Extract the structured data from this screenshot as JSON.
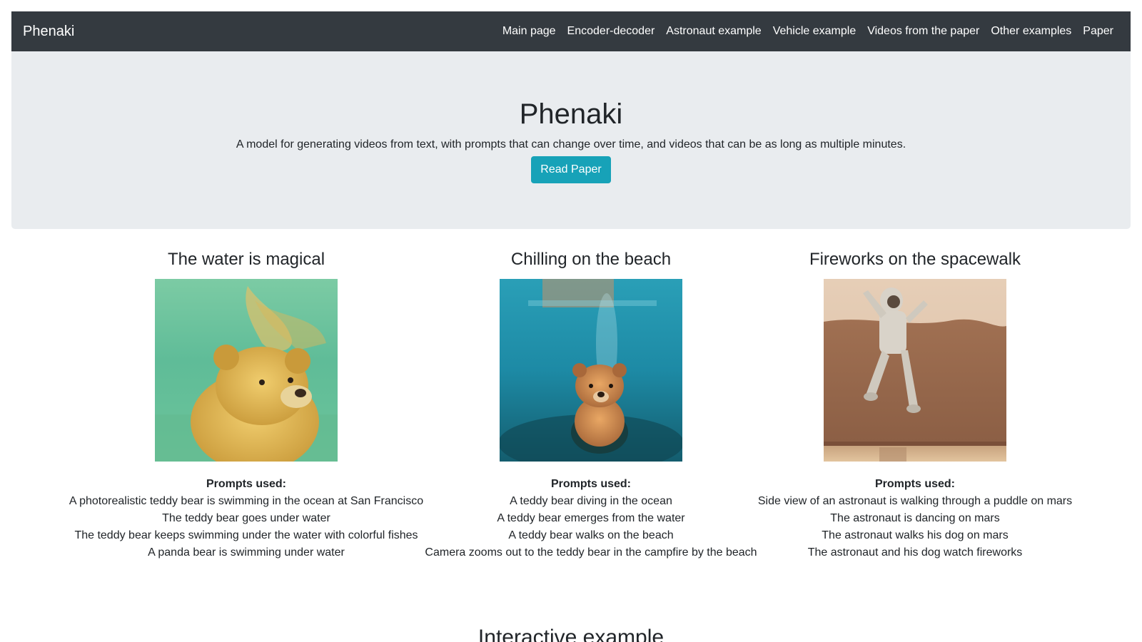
{
  "navbar": {
    "brand": "Phenaki",
    "links": [
      {
        "label": "Main page"
      },
      {
        "label": "Encoder-decoder"
      },
      {
        "label": "Astronaut example"
      },
      {
        "label": "Vehicle example"
      },
      {
        "label": "Videos from the paper"
      },
      {
        "label": "Other examples"
      },
      {
        "label": "Paper"
      }
    ]
  },
  "hero": {
    "title": "Phenaki",
    "subtitle": "A model for generating videos from text, with prompts that can change over time, and videos that can be as long as multiple minutes.",
    "button_label": "Read Paper"
  },
  "examples": [
    {
      "title": "The water is magical",
      "prompts_label": "Prompts used:",
      "prompts": [
        "A photorealistic teddy bear is swimming in the ocean at San Francisco",
        "The teddy bear goes under water",
        "The teddy bear keeps swimming under the water with colorful fishes",
        "A panda bear is swimming under water"
      ]
    },
    {
      "title": "Chilling on the beach",
      "prompts_label": "Prompts used:",
      "prompts": [
        "A teddy bear diving in the ocean",
        "A teddy bear emerges from the water",
        "A teddy bear walks on the beach",
        "Camera zooms out to the teddy bear in the campfire by the beach"
      ]
    },
    {
      "title": "Fireworks on the spacewalk",
      "prompts_label": "Prompts used:",
      "prompts": [
        "Side view of an astronaut is walking through a puddle on mars",
        "The astronaut is dancing on mars",
        "The astronaut walks his dog on mars",
        "The astronaut and his dog watch fireworks"
      ]
    }
  ],
  "next_section_title": "Interactive example",
  "colors": {
    "navbar_bg": "#343a40",
    "hero_bg": "#e9ecef",
    "button_bg": "#17a2b8",
    "text": "#212529"
  }
}
